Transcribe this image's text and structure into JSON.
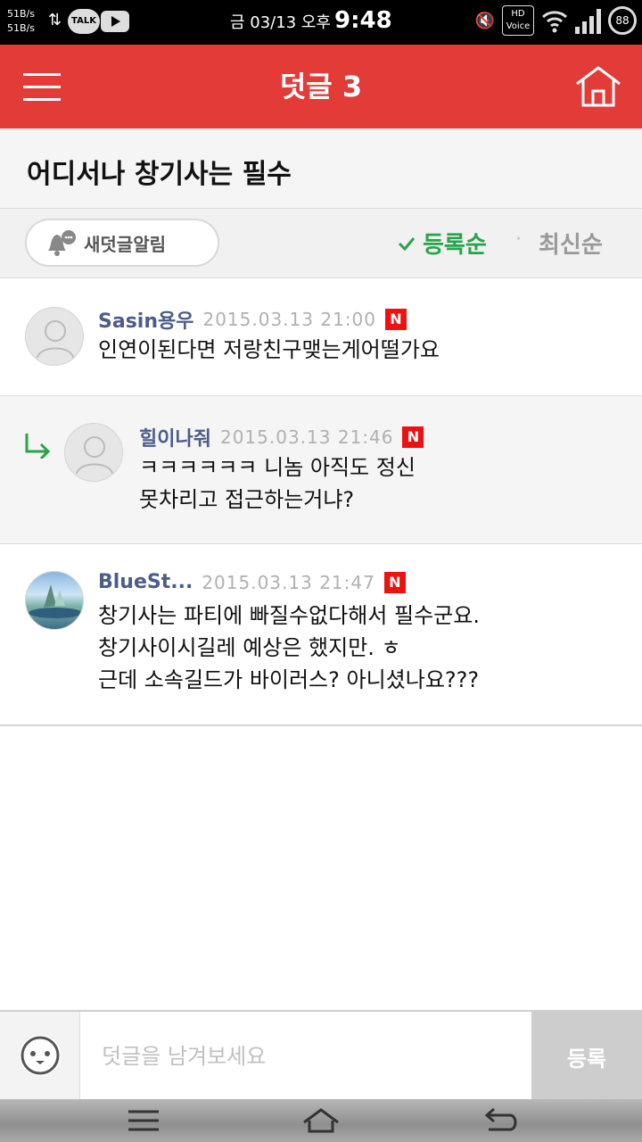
{
  "status_bar": {
    "net_up": "51B/s",
    "net_down": "51B/s",
    "talk_label": "TALK",
    "date": "금 03/13 오후",
    "time": "9:48",
    "hd_label": "HD",
    "voice_label": "Voice",
    "battery": "88"
  },
  "app_bar": {
    "title": "덧글 3",
    "menu_icon": "hamburger-menu-icon",
    "home_icon": "home-icon"
  },
  "post": {
    "title": "어디서나 창기사는 필수"
  },
  "sort_bar": {
    "notify_label": "새덧글알림",
    "sort_registered": "등록순",
    "sort_separator": "·",
    "sort_latest": "최신순",
    "active_color": "#27a44a"
  },
  "comments": [
    {
      "author": "Sasin용우",
      "date": "2015.03.13 21:00",
      "badge": "N",
      "lines": [
        "인연이된다면 저랑친구맺는게어떨가요"
      ]
    },
    {
      "author": "힐이나줘",
      "date": "2015.03.13 21:46",
      "badge": "N",
      "is_reply": true,
      "lines": [
        "ㅋㅋㅋㅋㅋㅋ 니놈 아직도 정신",
        "못차리고 접근하는거냐?"
      ]
    },
    {
      "author": "BlueSt...",
      "date": "2015.03.13 21:47",
      "badge": "N",
      "lines": [
        "창기사는 파티에 빠질수없다해서 필수군요.",
        "창기사이시길레 예상은 했지만. ㅎ",
        "근데 소속길드가 바이러스? 아니셨나요???"
      ]
    }
  ],
  "input_bar": {
    "placeholder": "덧글을 남겨보세요",
    "submit_label": "등록"
  },
  "colors": {
    "app_bar": "#e33b37",
    "author": "#4d5c8a",
    "badge": "#ee1111"
  }
}
